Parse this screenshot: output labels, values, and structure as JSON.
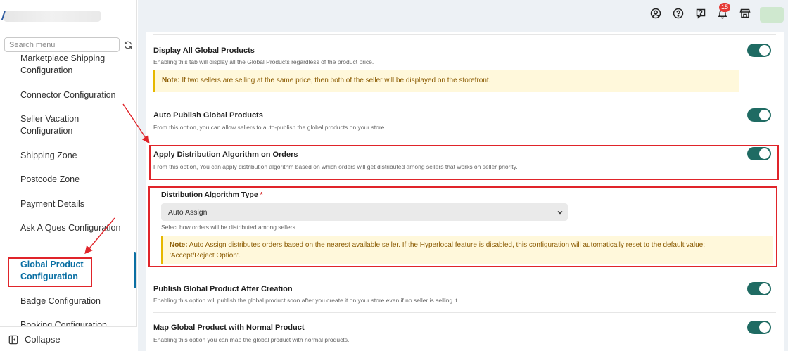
{
  "sidebar": {
    "search": {
      "placeholder": "Search menu",
      "value": ""
    },
    "items": [
      {
        "label": "Marketplace Shipping Configuration"
      },
      {
        "label": "Connector Configuration"
      },
      {
        "label": "Seller Vacation Configuration"
      },
      {
        "label": "Shipping Zone"
      },
      {
        "label": "Postcode Zone"
      },
      {
        "label": "Payment Details"
      },
      {
        "label": "Ask A Ques Configuration"
      },
      {
        "label": "Global Product Configuration",
        "active": true
      },
      {
        "label": "Badge Configuration"
      },
      {
        "label": "Booking Configuration"
      }
    ],
    "collapse_label": "Collapse"
  },
  "header": {
    "notification_count": "15",
    "icons": [
      "user-circle-icon",
      "help-circle-icon",
      "feedback-icon",
      "bell-icon",
      "store-icon"
    ]
  },
  "settings": [
    {
      "title": "Display All Global Products",
      "description": "Enabling this tab will display all the Global Products regardless of the product price.",
      "enabled": true,
      "note": {
        "prefix": "Note:",
        "text": " If two sellers are selling at the same price, then both of the seller will be displayed on the storefront."
      }
    },
    {
      "title": "Auto Publish Global Products",
      "description": "From this option, you can allow sellers to auto-publish the global products on your store.",
      "enabled": true
    },
    {
      "title": "Apply Distribution Algorithm on Orders",
      "description": "From this option, You can apply distribution algorithm based on which orders will get distributed among sellers that works on seller priority.",
      "enabled": true
    },
    {
      "title": "Publish Global Product After Creation",
      "description": "Enabling this option will publish the global product soon after you create it on your store even if no seller is selling it.",
      "enabled": true
    },
    {
      "title": "Map Global Product with Normal Product",
      "description": "Enabling this option you can map the global product with normal products.",
      "enabled": true
    }
  ],
  "distribution": {
    "label": "Distribution Algorithm Type",
    "required_mark": "*",
    "selected": "Auto Assign",
    "help": "Select how orders will be distributed among sellers.",
    "note_prefix": "Note:",
    "note_line1": " Auto Assign distributes orders based on the nearest available seller. If the Hyperlocal feature is disabled, this configuration will automatically reset to the default value:",
    "note_line2": "'Accept/Reject Option'."
  },
  "colors": {
    "toggle_on": "#1f6b63",
    "active_menu": "#0a6fa3",
    "annotation_red": "#e0242a",
    "note_bg": "#fff8db",
    "note_border": "#e6b800"
  }
}
